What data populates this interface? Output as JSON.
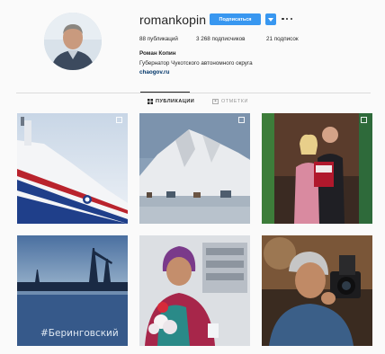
{
  "profile": {
    "username": "romankopin",
    "follow_label": "Подписаться",
    "stats": {
      "posts": "88 публикаций",
      "followers": "3 268 подписчиков",
      "following": "21 подписок"
    },
    "full_name": "Роман Копин",
    "bio": "Губернатор Чукотского автономного округа",
    "website": "chaogov.ru"
  },
  "tabs": [
    {
      "label": "ПУБЛИКАЦИИ",
      "active": true,
      "icon": "grid-icon"
    },
    {
      "label": "ОТМЕТКИ",
      "active": false,
      "icon": "tag-icon"
    }
  ],
  "posts": [
    {
      "id": "ship",
      "caption": ""
    },
    {
      "id": "mountain",
      "caption": ""
    },
    {
      "id": "couple-book",
      "caption": ""
    },
    {
      "id": "harbor",
      "caption": "#Беринговский"
    },
    {
      "id": "woman-flowers",
      "caption": ""
    },
    {
      "id": "photographer",
      "caption": ""
    }
  ],
  "colors": {
    "accent": "#3897f0",
    "link": "#003569",
    "divider": "#dbdbdb"
  }
}
